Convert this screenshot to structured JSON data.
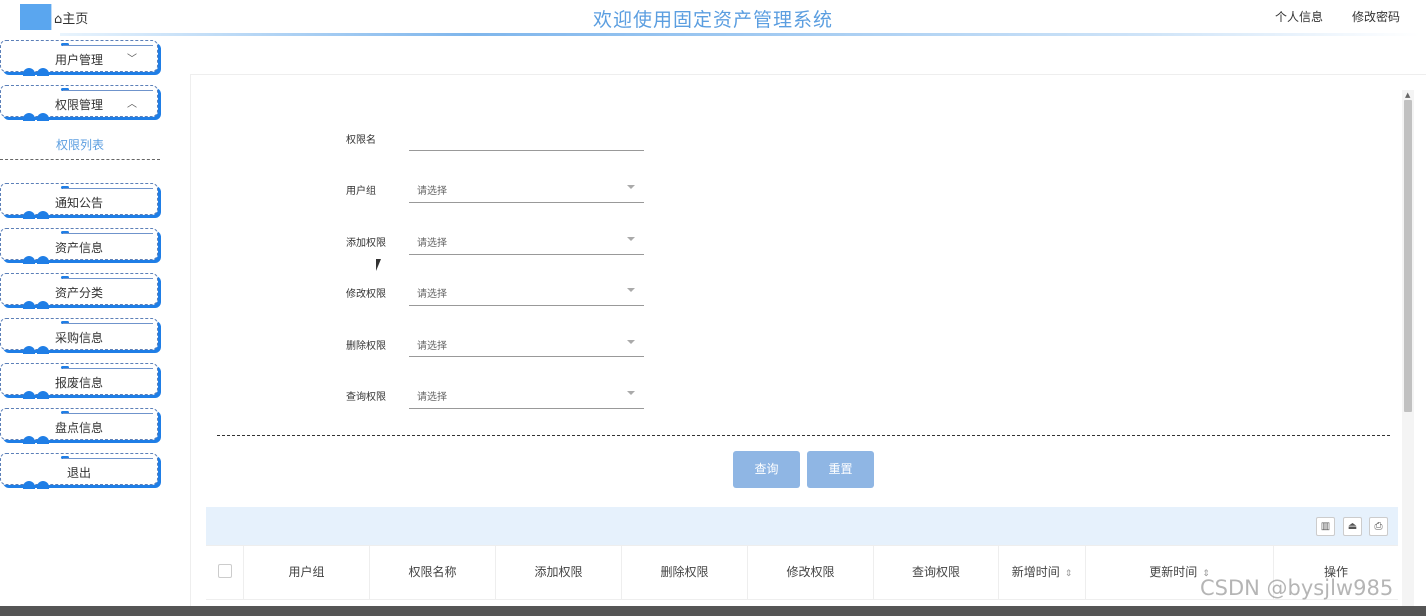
{
  "header": {
    "home": "⌂主页",
    "title": "欢迎使用固定资产管理系统",
    "links": [
      "个人信息",
      "修改密码"
    ]
  },
  "sidebar": {
    "items": [
      "用户管理",
      "权限管理",
      "通知公告",
      "资产信息",
      "资产分类",
      "采购信息",
      "报废信息",
      "盘点信息",
      "退出"
    ],
    "sub_item": "权限列表",
    "chev_down": "﹀",
    "chev_up": "︿"
  },
  "form": {
    "fields": [
      {
        "label": "权限名",
        "value": ""
      },
      {
        "label": "用户组",
        "value": "请选择"
      },
      {
        "label": "添加权限",
        "value": "请选择"
      },
      {
        "label": "修改权限",
        "value": "请选择"
      },
      {
        "label": "删除权限",
        "value": "请选择"
      },
      {
        "label": "查询权限",
        "value": "请选择"
      }
    ]
  },
  "buttons": {
    "search": "查询",
    "reset": "重置"
  },
  "table": {
    "columns": [
      "用户组",
      "权限名称",
      "添加权限",
      "删除权限",
      "修改权限",
      "查询权限",
      "新增时间",
      "更新时间",
      "操作"
    ],
    "sort_glyph": "⇕"
  },
  "watermark": "CSDN @bysjlw985",
  "colors": {
    "accent": "#5b9ee0",
    "button": "#8fb6e4",
    "menu_shadow": "#1f7ee6"
  }
}
